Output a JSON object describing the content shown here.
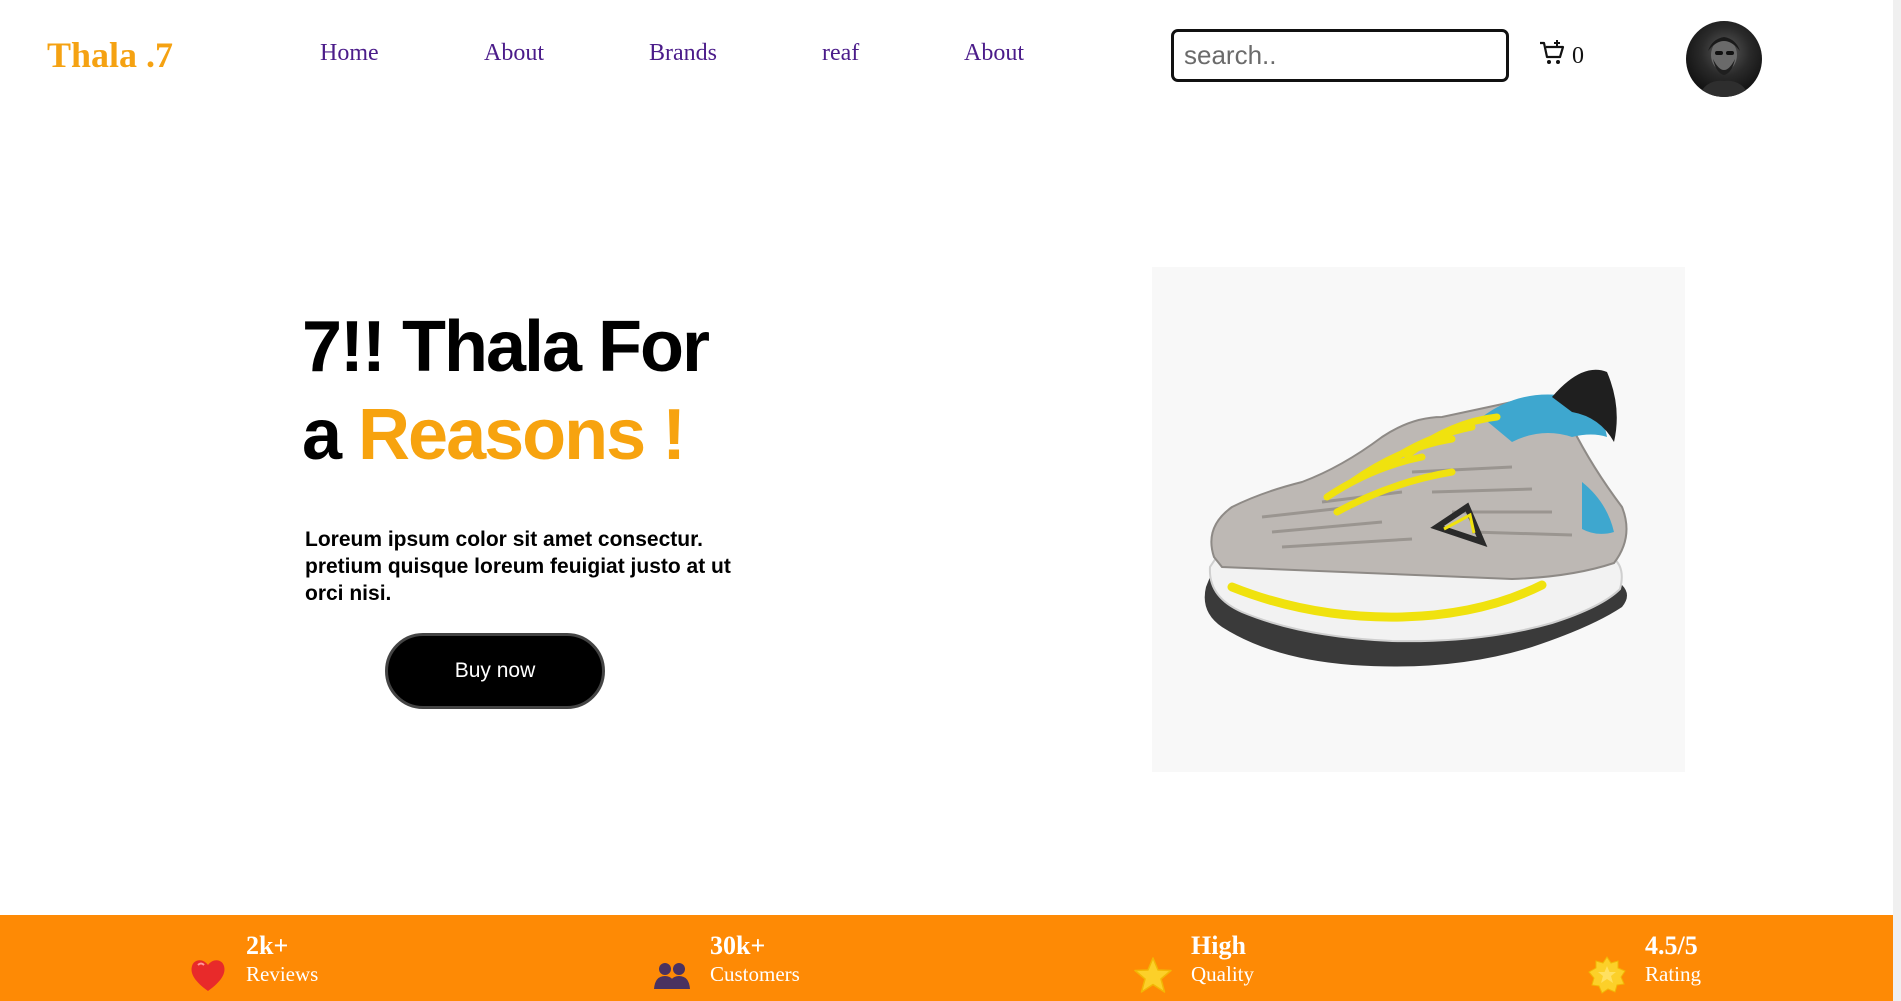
{
  "header": {
    "logo": "Thala .7",
    "nav": [
      {
        "label": "Home"
      },
      {
        "label": "About"
      },
      {
        "label": "Brands"
      },
      {
        "label": "reaf"
      },
      {
        "label": "About"
      }
    ],
    "search": {
      "placeholder": "search..",
      "value": ""
    },
    "cart": {
      "icon": "cart-plus-icon",
      "count": "0"
    },
    "avatar": {
      "icon": "user-avatar"
    }
  },
  "hero": {
    "title_line1": "7!! Thala For",
    "title_line2_plain": "a ",
    "title_line2_accent": "Reasons !",
    "description": "Loreum ipsum color sit amet consectur. pretium quisque loreum feuigiat justo at ut orci nisi.",
    "cta_label": "Buy now",
    "image": {
      "subject": "running-shoe",
      "alt": "grey and blue running shoe with yellow laces"
    }
  },
  "stats": [
    {
      "icon": "heart-icon",
      "value": "2k+",
      "label": "Reviews"
    },
    {
      "icon": "people-icon",
      "value": "30k+",
      "label": "Customers"
    },
    {
      "icon": "star-icon",
      "value": "High",
      "label": "Quality"
    },
    {
      "icon": "badge-star-icon",
      "value": "4.5/5",
      "label": "Rating"
    }
  ],
  "colors": {
    "logo": "#f5a212",
    "nav_text": "#4b1c8a",
    "accent": "#f7a30f",
    "stats_bar": "#fe8a05",
    "button_bg": "#000000"
  }
}
